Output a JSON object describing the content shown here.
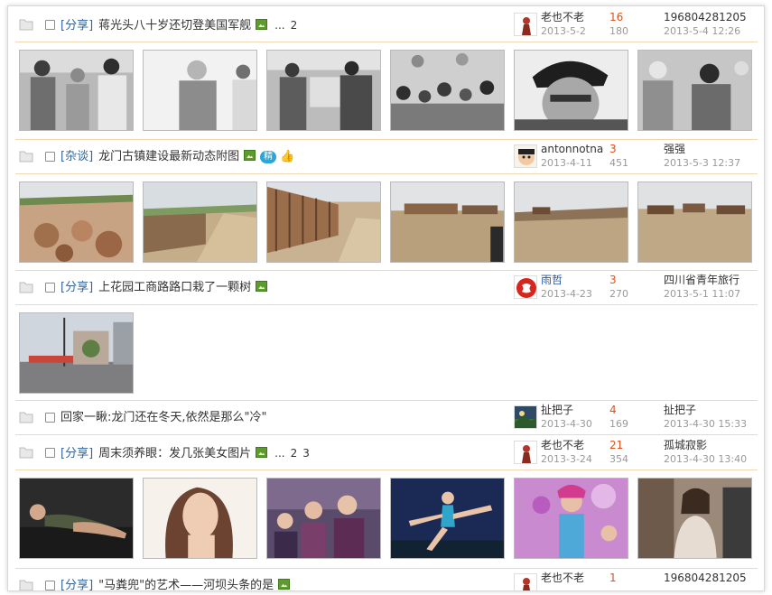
{
  "threads": [
    {
      "category": "[分享]",
      "title": "蒋光头八十岁还切登美国军舰",
      "pages": [
        "...",
        "2"
      ],
      "author": "老也不老",
      "post_date": "2013-5-2",
      "replies": "16",
      "views": "180",
      "last_user": "196804281205",
      "last_time": "2013-5-4 12:26"
    },
    {
      "category": "[杂谈]",
      "title": "龙门古镇建设最新动态附图",
      "badge": "精",
      "author": "antonnotna",
      "post_date": "2013-4-11",
      "replies": "3",
      "views": "451",
      "last_user": "强强",
      "last_time": "2013-5-3 12:37"
    },
    {
      "category": "[分享]",
      "title": "上花园工商路路口栽了一颗树",
      "author": "雨哲",
      "post_date": "2013-4-23",
      "replies": "3",
      "views": "270",
      "last_user": "四川省青年旅行",
      "last_time": "2013-5-1 11:07"
    },
    {
      "category": "",
      "title": "回家一瞅:龙门还在冬天,依然是那么\"冷\"",
      "author": "扯把子",
      "post_date": "2013-4-30",
      "replies": "4",
      "views": "169",
      "last_user": "扯把子",
      "last_time": "2013-4-30 15:33"
    },
    {
      "category": "[分享]",
      "title": "周末须养眼：发几张美女图片",
      "pages": [
        "...",
        "2",
        "3"
      ],
      "author": "老也不老",
      "post_date": "2013-3-24",
      "replies": "21",
      "views": "354",
      "last_user": "孤城寂影",
      "last_time": "2013-4-30 13:40"
    },
    {
      "category": "[分享]",
      "title": "\"马粪兜\"的艺术——河坝头条的是",
      "author": "老也不老",
      "post_date": "",
      "replies": "1",
      "views": "",
      "last_user": "196804281205",
      "last_time": ""
    }
  ],
  "icons": {
    "folder": "folder-icon",
    "image": "image-attachment-icon",
    "thumbs_up": "thumbs-up-icon"
  },
  "colors": {
    "category": "#336699",
    "replies": "#d9531e",
    "separator": "#f0d8b4",
    "badge": "#2aa7d9"
  }
}
